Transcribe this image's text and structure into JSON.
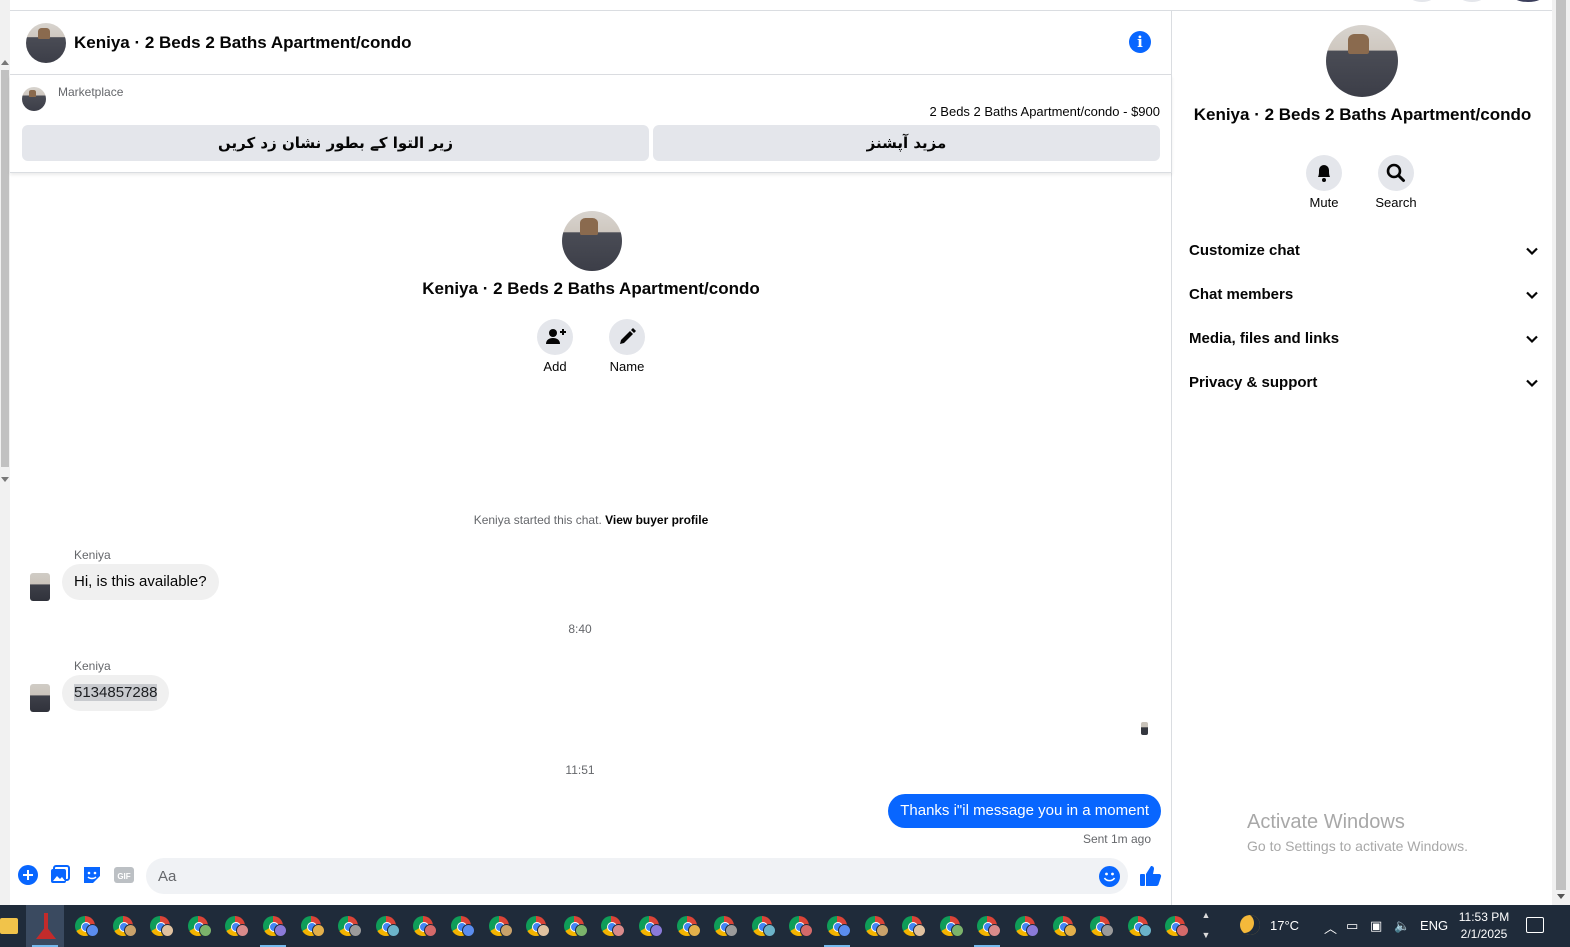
{
  "header": {
    "title": "Keniya · 2 Beds 2 Baths Apartment/condo"
  },
  "listing": {
    "marketplace_label": "Marketplace",
    "price_line": "2 Beds 2 Baths Apartment/condo - $900",
    "mark_sold_label": "زیر التوا کے بطور نشان زد کریں",
    "more_options_label": "مزید آپشنز"
  },
  "thread_intro": {
    "name": "Keniya · 2 Beds 2 Baths Apartment/condo",
    "add_label": "Add",
    "name_label": "Name",
    "system_prefix": "Keniya started this chat.",
    "system_link": "View buyer profile"
  },
  "messages": {
    "m1_sender": "Keniya",
    "m1_text": "Hi, is this available?",
    "time_1": "8:40",
    "m2_sender": "Keniya",
    "m2_text": "5134857288",
    "time_2": "11:51",
    "m3_text": "Thanks i\"il message you in a moment",
    "m3_status": "Sent 1m ago"
  },
  "composer": {
    "placeholder": "Aa"
  },
  "details": {
    "name": "Keniya · 2 Beds 2 Baths Apartment/condo",
    "mute_label": "Mute",
    "search_label": "Search",
    "sections": [
      "Customize chat",
      "Chat members",
      "Media, files and links",
      "Privacy & support"
    ],
    "watermark_title": "Activate Windows",
    "watermark_sub": "Go to Settings to activate Windows."
  },
  "taskbar": {
    "temperature": "17°C",
    "language": "ENG",
    "time": "11:53 PM",
    "date": "2/1/2025"
  },
  "colors": {
    "accent": "#0866ff",
    "bubble_in": "#f0f0f0",
    "taskbar": "#1f2b3a"
  }
}
